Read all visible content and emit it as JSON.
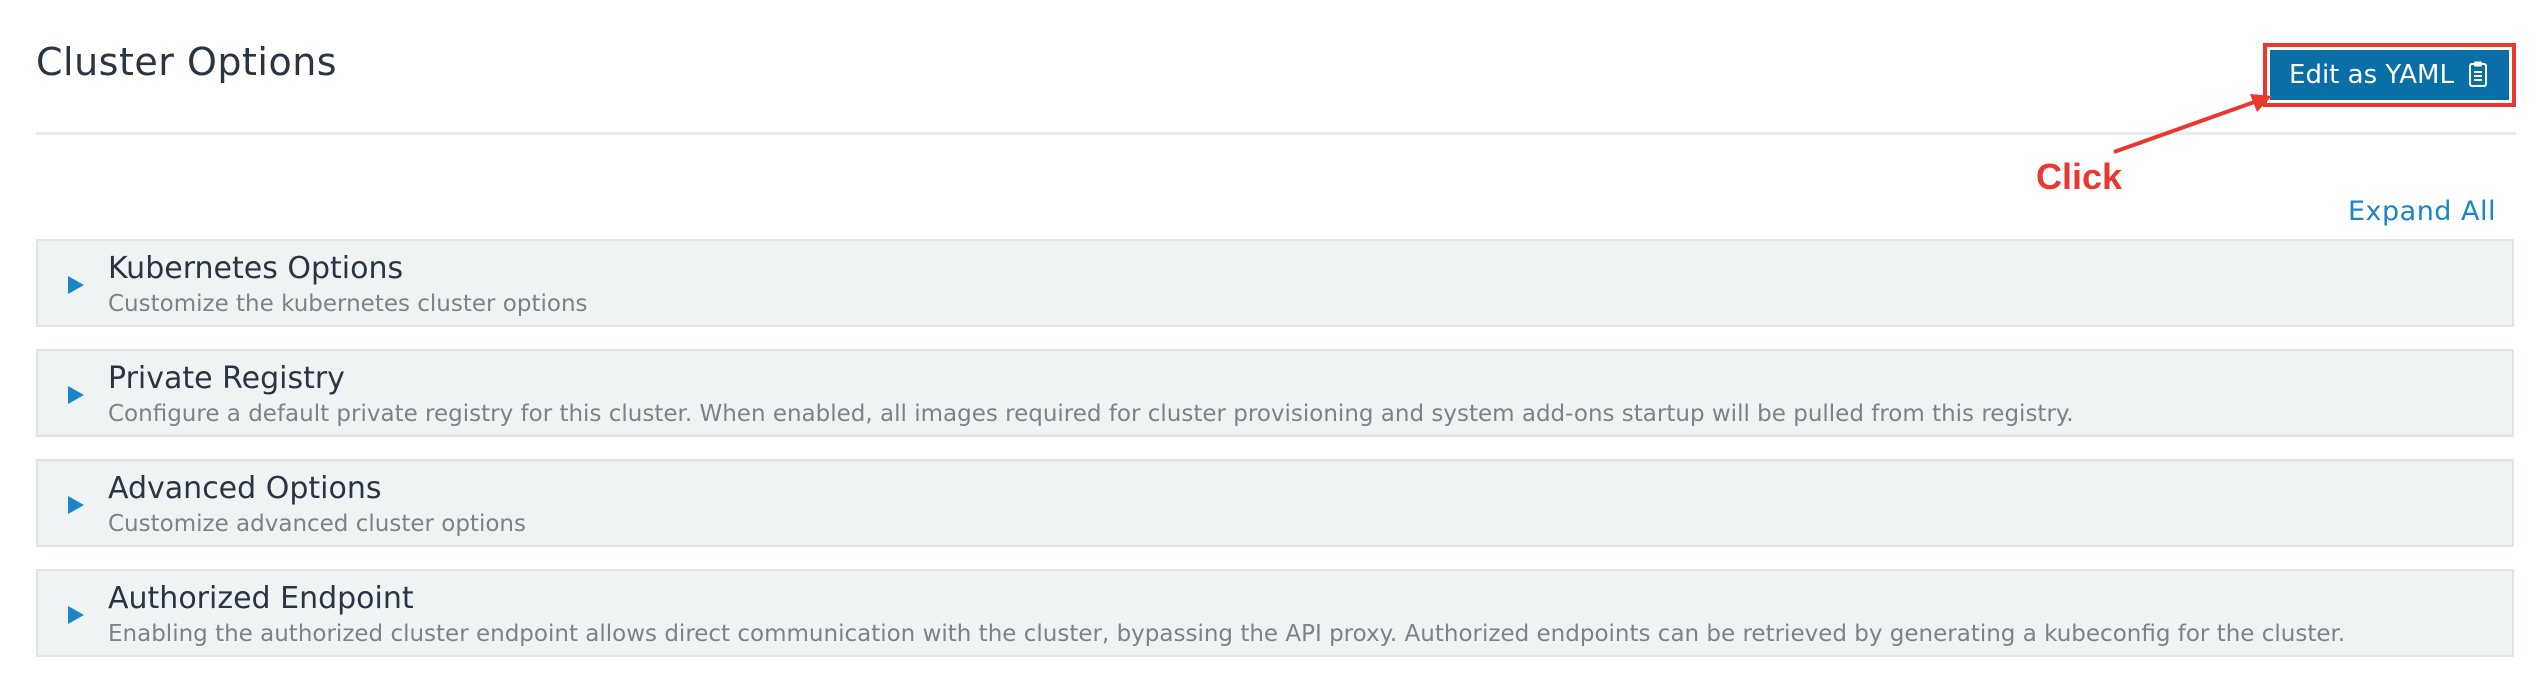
{
  "page": {
    "title": "Cluster Options"
  },
  "toolbar": {
    "edit_yaml_label": "Edit as YAML",
    "edit_yaml_icon": "clipboard-icon",
    "accent_color": "#0a6fa6"
  },
  "annotation": {
    "label": "Click",
    "color": "#e8382f"
  },
  "controls": {
    "expand_all_label": "Expand All"
  },
  "sections": [
    {
      "title": "Kubernetes Options",
      "description": "Customize the kubernetes cluster options",
      "expanded": false
    },
    {
      "title": "Private Registry",
      "description": "Configure a default private registry for this cluster. When enabled, all images required for cluster provisioning and system add-ons startup will be pulled from this registry.",
      "expanded": false
    },
    {
      "title": "Advanced Options",
      "description": "Customize advanced cluster options",
      "expanded": false
    },
    {
      "title": "Authorized Endpoint",
      "description": "Enabling the authorized cluster endpoint allows direct communication with the cluster, bypassing the API proxy. Authorized endpoints can be retrieved by generating a kubeconfig for the cluster.",
      "expanded": false
    }
  ]
}
